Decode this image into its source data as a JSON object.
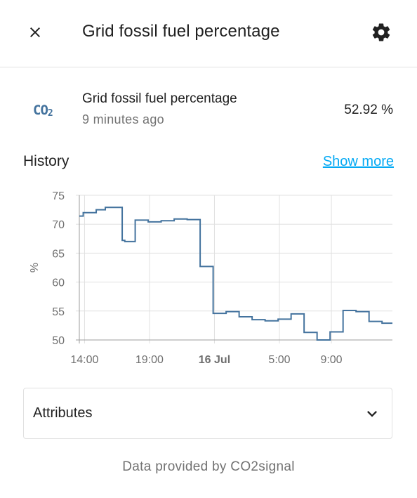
{
  "dialog": {
    "title": "Grid fossil fuel percentage",
    "close_icon": "close-icon",
    "settings_icon": "gear-icon"
  },
  "entity": {
    "icon": "co2-icon",
    "icon_text": "CO",
    "icon_sub": "2",
    "name": "Grid fossil fuel percentage",
    "last_changed": "9 minutes ago",
    "state": "52.92 %"
  },
  "history": {
    "title": "History",
    "show_more": "Show more"
  },
  "chart_data": {
    "type": "line",
    "step": true,
    "ylabel": "%",
    "xlabel": "",
    "ylim": [
      50,
      75
    ],
    "y_ticks": [
      50,
      55,
      60,
      65,
      70,
      75
    ],
    "x_ticks": [
      {
        "label": "14:00",
        "hour": 14,
        "bold": false
      },
      {
        "label": "19:00",
        "hour": 19,
        "bold": false
      },
      {
        "label": "16 Jul",
        "hour": 24,
        "bold": true
      },
      {
        "label": "5:00",
        "hour": 29,
        "bold": false
      },
      {
        "label": "9:00",
        "hour": 33,
        "bold": false
      }
    ],
    "xlim_hours": [
      13.6,
      37.7
    ],
    "grid": true,
    "line_color": "#44739e",
    "series": [
      {
        "points": [
          {
            "hour": 13.6,
            "value": 71.4
          },
          {
            "hour": 13.9,
            "value": 72.0
          },
          {
            "hour": 14.9,
            "value": 72.5
          },
          {
            "hour": 15.6,
            "value": 72.9
          },
          {
            "hour": 16.9,
            "value": 67.2
          },
          {
            "hour": 17.1,
            "value": 67.0
          },
          {
            "hour": 17.9,
            "value": 70.7
          },
          {
            "hour": 18.9,
            "value": 70.4
          },
          {
            "hour": 19.9,
            "value": 70.6
          },
          {
            "hour": 20.9,
            "value": 70.9
          },
          {
            "hour": 21.9,
            "value": 70.8
          },
          {
            "hour": 22.9,
            "value": 62.7
          },
          {
            "hour": 23.9,
            "value": 54.6
          },
          {
            "hour": 24.9,
            "value": 54.9
          },
          {
            "hour": 25.9,
            "value": 54.0
          },
          {
            "hour": 26.9,
            "value": 53.5
          },
          {
            "hour": 27.9,
            "value": 53.3
          },
          {
            "hour": 28.9,
            "value": 53.6
          },
          {
            "hour": 29.9,
            "value": 54.5
          },
          {
            "hour": 30.9,
            "value": 51.3
          },
          {
            "hour": 31.9,
            "value": 50.0
          },
          {
            "hour": 32.9,
            "value": 51.4
          },
          {
            "hour": 33.9,
            "value": 55.1
          },
          {
            "hour": 34.9,
            "value": 54.9
          },
          {
            "hour": 35.9,
            "value": 53.2
          },
          {
            "hour": 36.9,
            "value": 52.9
          }
        ]
      }
    ]
  },
  "attributes": {
    "label": "Attributes",
    "chevron_icon": "chevron-down-icon"
  },
  "footer": {
    "attribution": "Data provided by CO2signal"
  }
}
